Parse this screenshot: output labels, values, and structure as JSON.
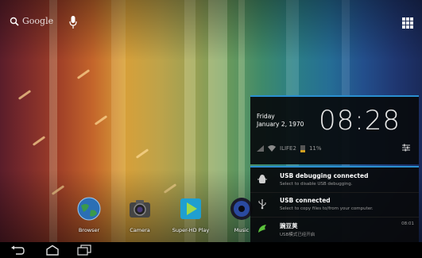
{
  "search": {
    "label": "Google"
  },
  "dock": [
    {
      "label": "Browser",
      "icon": "globe-icon"
    },
    {
      "label": "Camera",
      "icon": "camera-icon"
    },
    {
      "label": "Super-HD Play",
      "icon": "play-icon"
    },
    {
      "label": "Music",
      "icon": "music-icon"
    }
  ],
  "clock": {
    "day": "Friday",
    "date": "January 2, 1970",
    "time": "08:28",
    "wifi_name": "ILIFE2",
    "battery": "11%"
  },
  "notifications": [
    {
      "title": "USB debugging connected",
      "subtitle": "Select to disable USB debugging.",
      "time": "",
      "icon": "android-debug-icon"
    },
    {
      "title": "USB connected",
      "subtitle": "Select to copy files to/from your computer.",
      "time": "",
      "icon": "usb-icon"
    },
    {
      "title": "豌豆荚",
      "subtitle": "USB模式已经开启",
      "time": "08:01",
      "icon": "wandoujia-icon"
    }
  ],
  "colors": {
    "accent": "#2a8fd0"
  }
}
